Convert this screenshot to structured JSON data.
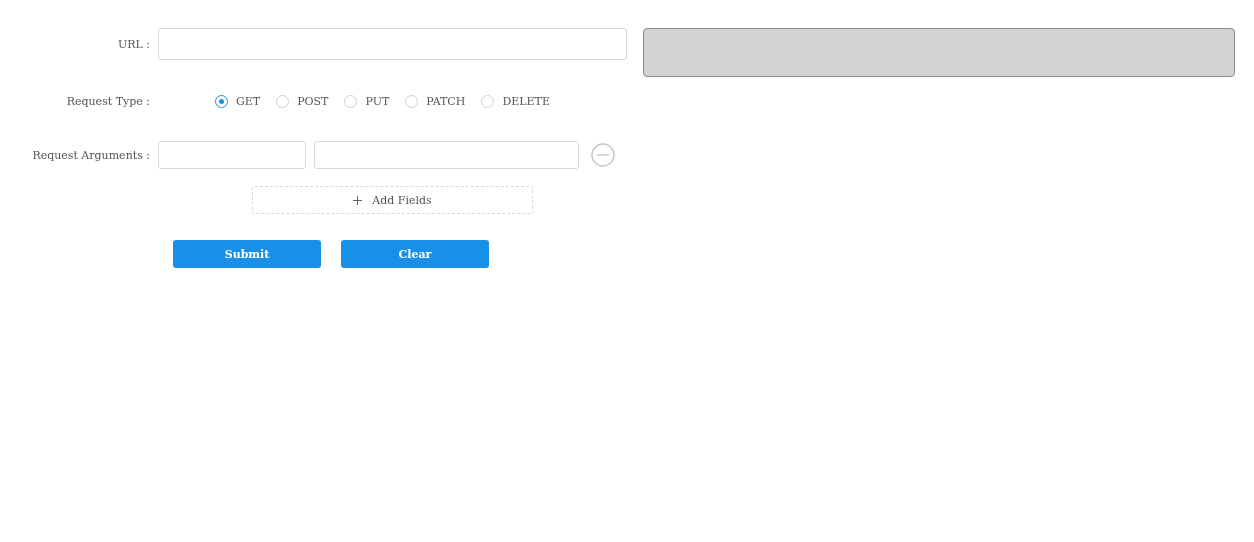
{
  "url": {
    "label": "URL :"
  },
  "request_type": {
    "label": "Request Type :",
    "options": [
      {
        "label": "GET",
        "selected": true
      },
      {
        "label": "POST",
        "selected": false
      },
      {
        "label": "PUT",
        "selected": false
      },
      {
        "label": "PATCH",
        "selected": false
      },
      {
        "label": "DELETE",
        "selected": false
      }
    ]
  },
  "request_arguments": {
    "label": "Request Arguments :",
    "add_button": "Add Fields"
  },
  "buttons": [
    "Submit",
    "Clear"
  ]
}
